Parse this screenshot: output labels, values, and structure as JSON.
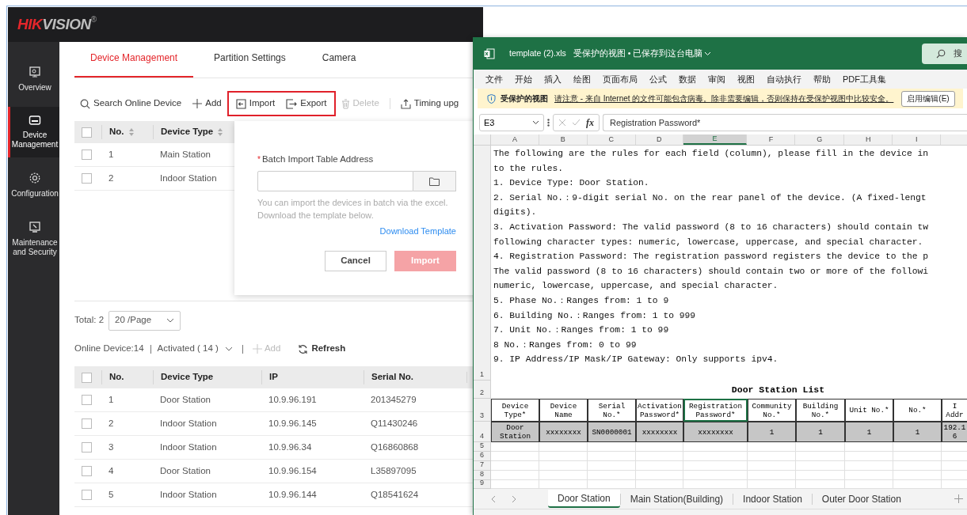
{
  "app": {
    "logo_primary": "HIK",
    "logo_secondary": "VISION",
    "logo_mark": "®",
    "sidebar": [
      {
        "label": "Overview",
        "selected": false
      },
      {
        "label": "Device Management",
        "selected": true
      },
      {
        "label": "Configuration",
        "selected": false
      },
      {
        "label": "Maintenance and Security",
        "selected": false
      }
    ],
    "tabs": [
      {
        "label": "Device Management",
        "selected": true
      },
      {
        "label": "Partition Settings",
        "selected": false
      },
      {
        "label": "Camera",
        "selected": false
      }
    ],
    "toolbar": [
      {
        "kind": "search",
        "label": "Search Online Device",
        "disabled": false,
        "highlighted": false
      },
      {
        "kind": "add",
        "label": "Add",
        "disabled": false,
        "highlighted": false
      },
      {
        "kind": "import",
        "label": "Import",
        "disabled": false,
        "highlighted": true
      },
      {
        "kind": "export",
        "label": "Export",
        "disabled": false,
        "highlighted": true
      },
      {
        "kind": "delete",
        "label": "Delete",
        "disabled": true,
        "highlighted": false
      },
      {
        "kind": "upgrade",
        "label": "Timing upg",
        "disabled": false,
        "highlighted": false
      }
    ],
    "device_list": {
      "all_checked": false,
      "columns": [
        "No.",
        "Device Type"
      ],
      "rows": [
        {
          "checked": false,
          "cells": [
            "1",
            "Main Station"
          ]
        },
        {
          "checked": false,
          "cells": [
            "2",
            "Indoor Station"
          ]
        }
      ]
    },
    "import_dialog": {
      "required_mark": "*",
      "label": "Batch Import Table Address",
      "hint": "You can import the devices in batch via the excel. Download the template below.",
      "link": "Download Template",
      "buttons": [
        {
          "label": "Cancel",
          "primary": false,
          "disabled": false
        },
        {
          "label": "Import",
          "primary": true,
          "disabled": true
        }
      ]
    },
    "pagination": {
      "total": "Total: 2",
      "page_size": "20 /Page"
    },
    "online_bar": {
      "count": "Online Device:14",
      "filter": "Activated ( 14 )",
      "add": {
        "label": "Add",
        "disabled": true
      },
      "refresh": "Refresh"
    },
    "online_table": {
      "all_checked": false,
      "columns": [
        "No.",
        "Device Type",
        "IP",
        "Serial No."
      ],
      "rows": [
        {
          "checked": false,
          "cells": [
            "1",
            "Door Station",
            "10.9.96.191",
            "201345279"
          ]
        },
        {
          "checked": false,
          "cells": [
            "2",
            "Indoor Station",
            "10.9.96.145",
            "Q11430246"
          ]
        },
        {
          "checked": false,
          "cells": [
            "3",
            "Indoor Station",
            "10.9.96.34",
            "Q16860868"
          ]
        },
        {
          "checked": false,
          "cells": [
            "4",
            "Door Station",
            "10.9.96.154",
            "L35897095"
          ]
        },
        {
          "checked": false,
          "cells": [
            "5",
            "Indoor Station",
            "10.9.96.144",
            "Q18541624"
          ]
        }
      ]
    }
  },
  "excel": {
    "file_name": "template (2).xls",
    "save_state": "受保护的视图 • 已保存到这台电脑",
    "search": "搜",
    "menu": [
      "文件",
      "开始",
      "插入",
      "绘图",
      "页面布局",
      "公式",
      "数据",
      "审阅",
      "视图",
      "自动执行",
      "帮助",
      "PDF工具集"
    ],
    "protected_bar": {
      "title": "受保护的视图",
      "message": "请注意 - 来自 Internet 的文件可能包含病毒。除非需要编辑，否则保持在受保护视图中比较安全。",
      "button": "启用编辑(E)"
    },
    "formula_bar": {
      "cell": "E3",
      "function_label": "fx",
      "value": "Registration Password*"
    },
    "columns": [
      {
        "label": "A",
        "selected": false
      },
      {
        "label": "B",
        "selected": false
      },
      {
        "label": "C",
        "selected": false
      },
      {
        "label": "D",
        "selected": false
      },
      {
        "label": "E",
        "selected": true
      },
      {
        "label": "F",
        "selected": false
      },
      {
        "label": "G",
        "selected": false
      },
      {
        "label": "H",
        "selected": false
      },
      {
        "label": "I",
        "selected": false
      }
    ],
    "notes": [
      "The following are the rules for each field (column), please fill in the device in",
      "to the rules.",
      "1. Device Type: Door Station.",
      "2. Serial No.：9-digit serial No. on the rear panel of the device. (A fixed-lengt",
      "digits).",
      "3. Activation Password: The valid password (8 to 16 characters) should contain tw",
      "following character types: numeric, lowercase, uppercase, and special character.",
      "4. Registration Password: The registration password registers the device to the p",
      "The valid password (8 to 16 characters) should contain two or more of the followi",
      "numeric, lowercase, uppercase, and special character.",
      "5. Phase No.：Ranges from: 1 to 9",
      "6. Building No.：Ranges from: 1 to 999",
      "7. Unit No.：Ranges from: 1 to 99",
      "8 No.：Ranges from: 0 to 99",
      "9. IP Address/IP Mask/IP Gateway: Only supports ipv4."
    ],
    "row_numbers": [
      "1",
      "2",
      "3",
      "4",
      "5",
      "6",
      "7",
      "8",
      "9"
    ],
    "list_title": "Door Station List",
    "header_cells": [
      {
        "text": "Device Type*",
        "selected": false
      },
      {
        "text": "Device Name",
        "selected": false
      },
      {
        "text": "Serial No.*",
        "selected": false
      },
      {
        "text": "Activation Password*",
        "selected": false
      },
      {
        "text": "Registration Password*",
        "selected": true
      },
      {
        "text": "Community No.*",
        "selected": false
      },
      {
        "text": "Building No.*",
        "selected": false
      },
      {
        "text": "Unit No.*",
        "selected": false
      },
      {
        "text": "No.*",
        "selected": false
      },
      {
        "text": "I Addr",
        "selected": false
      }
    ],
    "data_cells": [
      "Door Station",
      "xxxxxxxx",
      "SN0000001",
      "xxxxxxxx",
      "xxxxxxxx",
      "1",
      "1",
      "1",
      "1",
      "192.1 6"
    ],
    "sheet_tabs": [
      {
        "label": "Door Station",
        "selected": true
      },
      {
        "label": "Main Station(Building)",
        "selected": false
      },
      {
        "label": "Indoor Station",
        "selected": false
      },
      {
        "label": "Outer Door Station",
        "selected": false
      }
    ]
  }
}
